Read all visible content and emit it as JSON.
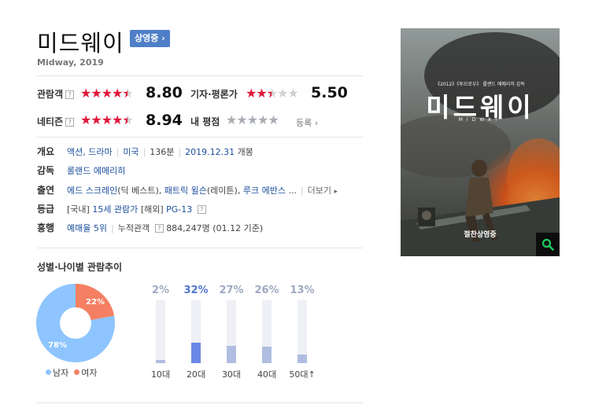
{
  "movie": {
    "title": "미드웨이",
    "status_badge": "상영중",
    "subtitle": "Midway, 2019"
  },
  "ratings": {
    "audience": {
      "label": "관람객",
      "score": "8.80",
      "stars": 4.5
    },
    "critic": {
      "label": "기자·평론가",
      "score": "5.50",
      "stars": 2.5
    },
    "netizen": {
      "label": "네티즌",
      "score": "8.94",
      "stars": 4.5
    },
    "my_rating": {
      "label": "내 평점",
      "register": "등록"
    },
    "help_glyph": "?"
  },
  "info": {
    "overview": {
      "label": "개요",
      "genre": "액션, 드라마",
      "country": "미국",
      "runtime": "136분",
      "release": "2019.12.31",
      "release_suffix": "개봉"
    },
    "director": {
      "label": "감독",
      "name": "롤랜드 에메리히"
    },
    "cast": {
      "label": "출연",
      "c1": "에드 스크레인",
      "c1_role": "(딕 베스트),",
      "c2": "패트릭 윌슨",
      "c2_role": "(레이튼),",
      "c3": "루크 에반스",
      "more_suffix": " ...",
      "more": "더보기"
    },
    "rating_grade": {
      "label": "등급",
      "domestic_tag": "[국내]",
      "domestic": "15세 관람가",
      "overseas_tag": "[해외]",
      "overseas": "PG-13"
    },
    "box_office": {
      "label": "흥행",
      "rank": "예매율 5위",
      "cumulative_label": "누적관객",
      "cumulative": "884,247명",
      "as_of": "(01.12 기준)"
    }
  },
  "poster": {
    "tagline": "《2012》《투모로우》 롤랜드 에메리히 감독",
    "title": "미드웨이",
    "subtitle": "MIDWAY",
    "bottom_text": "절찬상영중",
    "zoom_icon": "search-icon"
  },
  "demographics": {
    "title": "성별·나이별 관람추이",
    "gender": {
      "male_label": "남자",
      "female_label": "여자",
      "male_pct": "78%",
      "female_pct": "22%",
      "male_value": 78,
      "female_value": 22,
      "male_color": "#8ec5ff",
      "female_color": "#f47f63"
    },
    "age": [
      {
        "label": "10대",
        "pct": "2%",
        "value": 2
      },
      {
        "label": "20대",
        "pct": "32%",
        "value": 32
      },
      {
        "label": "30대",
        "pct": "27%",
        "value": 27
      },
      {
        "label": "40대",
        "pct": "26%",
        "value": 26
      },
      {
        "label": "50대↑",
        "pct": "13%",
        "value": 13
      }
    ]
  }
}
